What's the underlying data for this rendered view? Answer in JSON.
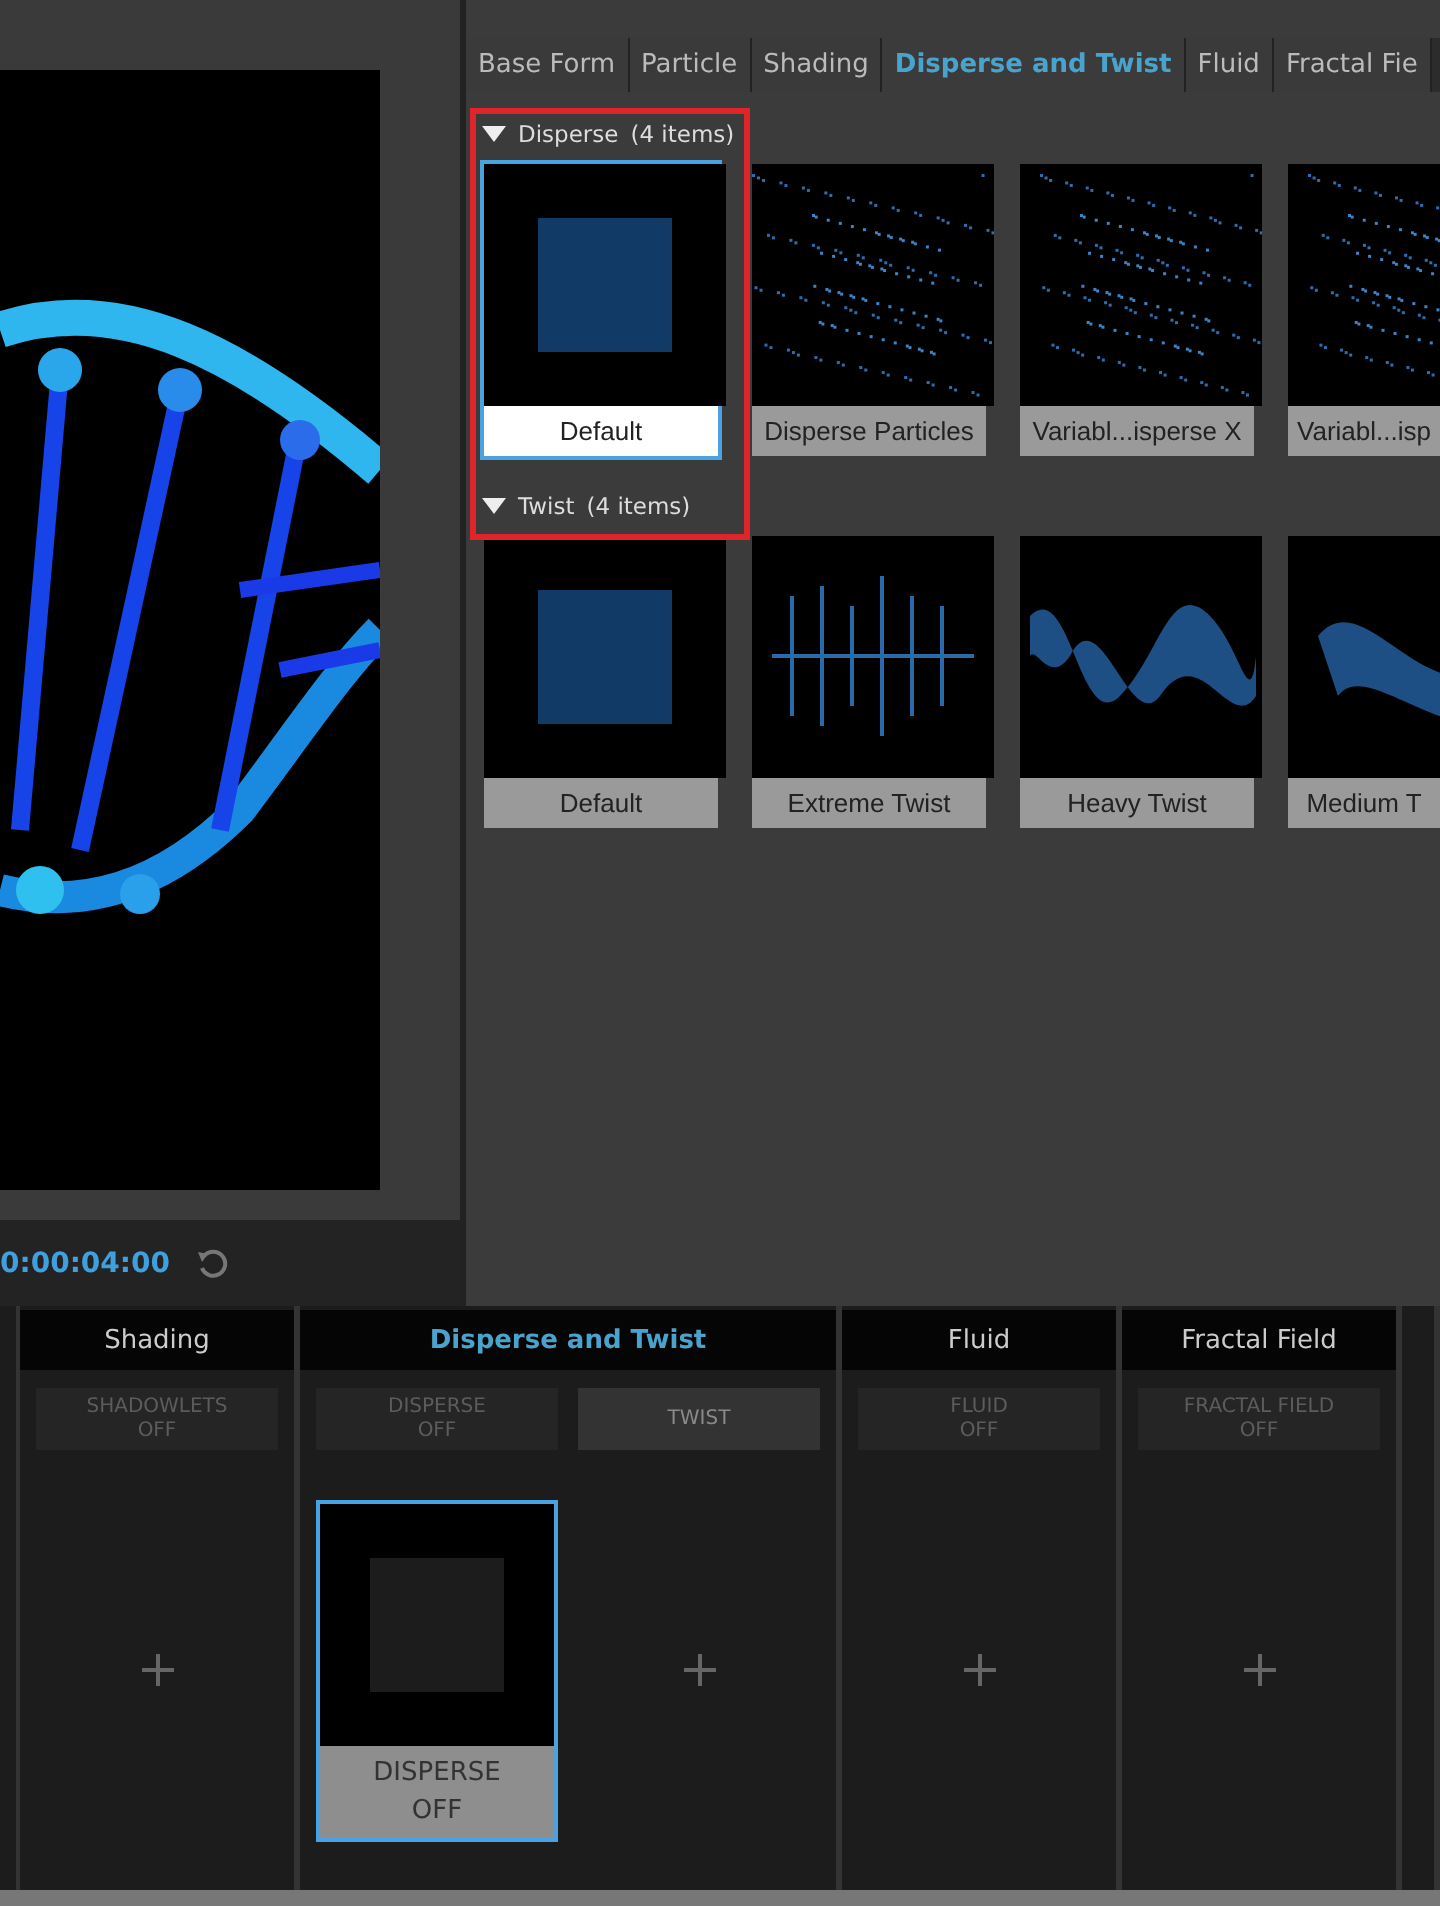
{
  "tabs": [
    {
      "label": "Base Form",
      "selected": false
    },
    {
      "label": "Particle",
      "selected": false
    },
    {
      "label": "Shading",
      "selected": false
    },
    {
      "label": "Disperse and Twist",
      "selected": true
    },
    {
      "label": "Fluid",
      "selected": false
    },
    {
      "label": "Fractal Fie",
      "selected": false
    }
  ],
  "groups": [
    {
      "title": "Disperse",
      "count": "(4 items)",
      "expanded": true,
      "presets": [
        {
          "label": "Default",
          "selected": true
        },
        {
          "label": "Disperse Particles",
          "selected": false
        },
        {
          "label": "Variabl...isperse X",
          "selected": false
        },
        {
          "label": "Variabl...isp",
          "selected": false
        }
      ]
    },
    {
      "title": "Twist",
      "count": "(4 items)",
      "expanded": true,
      "presets": [
        {
          "label": "Default",
          "selected": false
        },
        {
          "label": "Extreme Twist",
          "selected": false
        },
        {
          "label": "Heavy Twist",
          "selected": false
        },
        {
          "label": "Medium T",
          "selected": false
        }
      ]
    }
  ],
  "timecode": "0:00:04:00",
  "columns": [
    {
      "title": "Shading",
      "selected": false,
      "lanes": [
        {
          "slot": "SHADOWLETS",
          "state": "OFF",
          "active": false
        }
      ]
    },
    {
      "title": "Disperse and Twist",
      "selected": true,
      "lanes": [
        {
          "slot": "DISPERSE",
          "state": "OFF",
          "active": false,
          "card": {
            "title": "DISPERSE",
            "state": "OFF",
            "selected": true
          }
        },
        {
          "slot": "TWIST",
          "active": true
        }
      ]
    },
    {
      "title": "Fluid",
      "selected": false,
      "lanes": [
        {
          "slot": "FLUID",
          "state": "OFF",
          "active": false
        }
      ]
    },
    {
      "title": "Fractal Field",
      "selected": false,
      "lanes": [
        {
          "slot": "FRACTAL FIELD",
          "state": "OFF",
          "active": false
        }
      ]
    }
  ]
}
